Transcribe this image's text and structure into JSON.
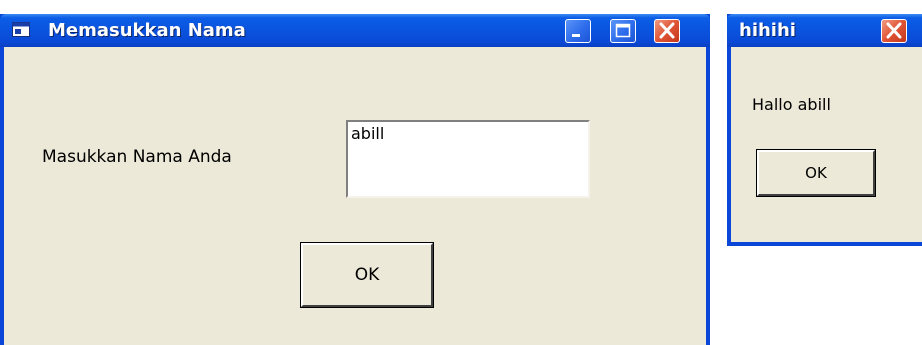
{
  "main_window": {
    "title": "Memasukkan Nama",
    "label": "Masukkan Nama Anda",
    "input_value": "abill",
    "ok_label": "OK",
    "icons": {
      "app": "app-window-icon",
      "minimize": "minimize-icon",
      "maximize": "maximize-icon",
      "close": "close-icon"
    }
  },
  "message_box": {
    "title": "hihihi",
    "message": "Hallo abill",
    "ok_label": "OK",
    "icons": {
      "close": "close-icon"
    }
  },
  "colors": {
    "titlebar": "#0A52DD",
    "client_bg": "#ECE9D8",
    "close_button": "#E05536"
  }
}
